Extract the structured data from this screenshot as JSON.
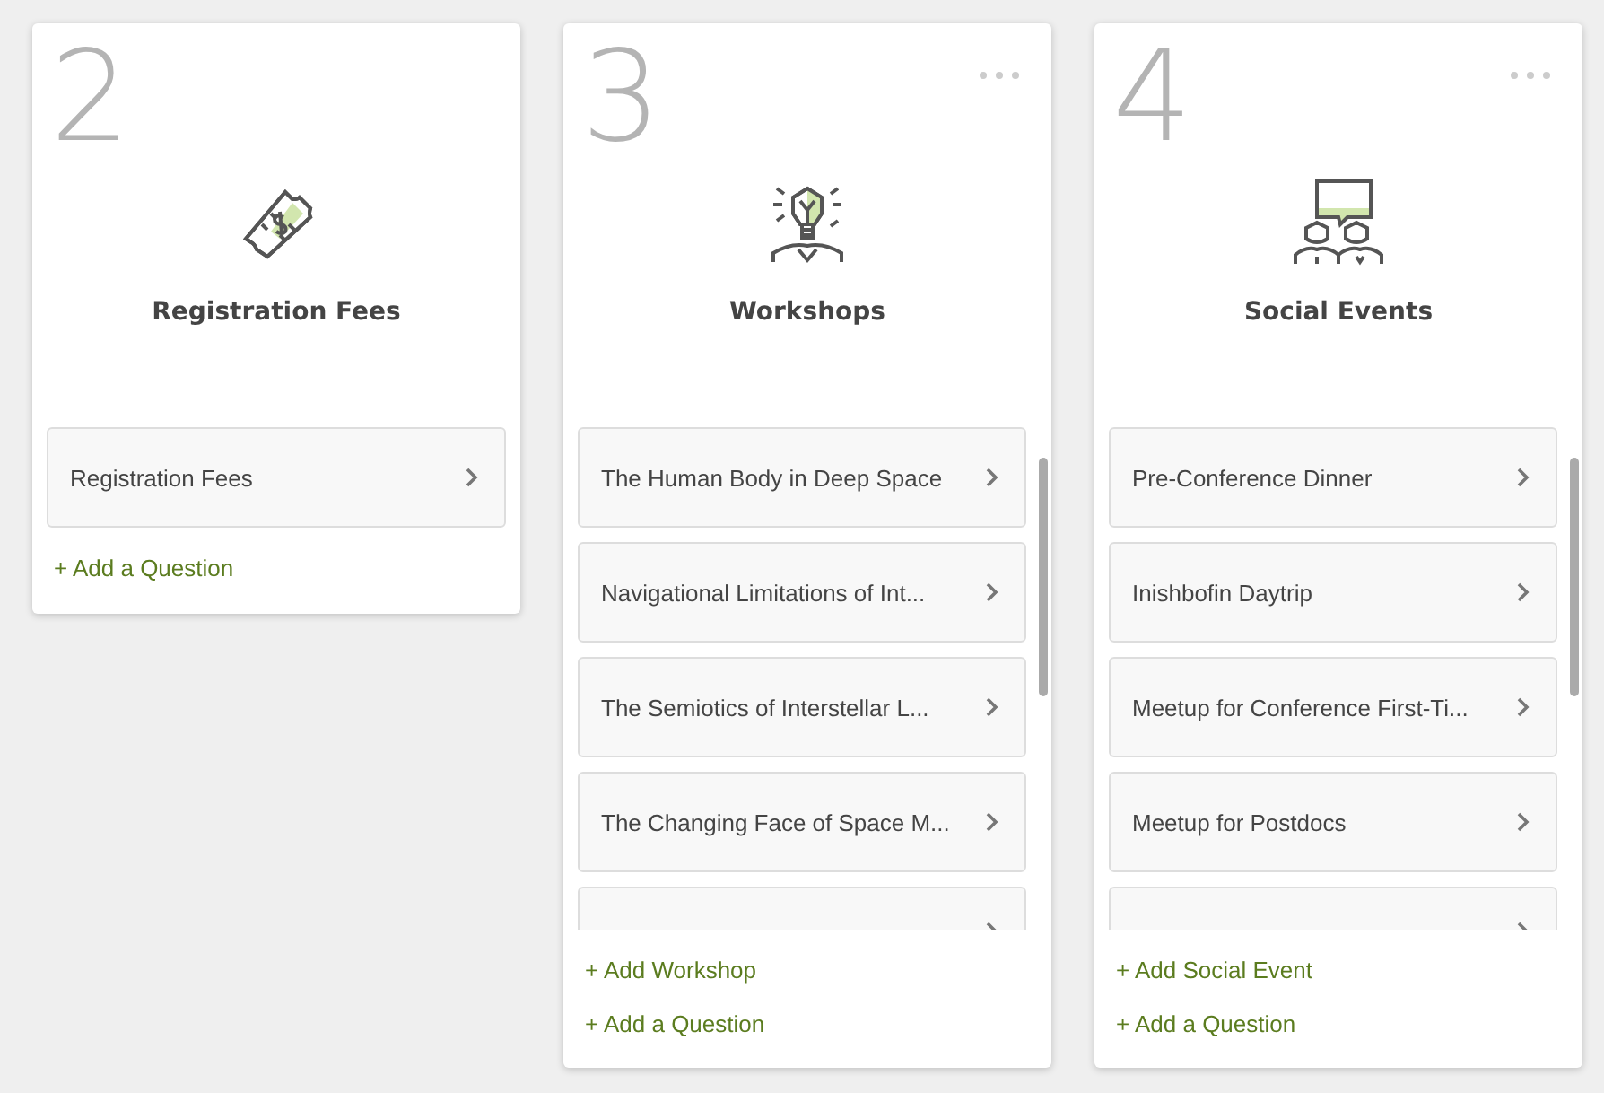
{
  "columns": [
    {
      "number": "2",
      "title": "Registration Fees",
      "menu": false,
      "scrollable": false,
      "items": [
        {
          "kind": "full",
          "label": "Registration Fees"
        }
      ],
      "links": [
        "+ Add a Question"
      ]
    },
    {
      "number": "3",
      "title": "Workshops",
      "menu": true,
      "scrollable": true,
      "items": [
        {
          "kind": "full",
          "label": "The Human Body in Deep Space"
        },
        {
          "kind": "full",
          "label": "Navigational Limitations of Int..."
        },
        {
          "kind": "full",
          "label": "The Semiotics of Interstellar L..."
        },
        {
          "kind": "full",
          "label": "The Changing Face of Space M..."
        },
        {
          "kind": "partial"
        }
      ],
      "links": [
        "+ Add Workshop",
        "+ Add a Question"
      ]
    },
    {
      "number": "4",
      "title": "Social Events",
      "menu": true,
      "scrollable": true,
      "items": [
        {
          "kind": "full",
          "label": "Pre-Conference Dinner"
        },
        {
          "kind": "full",
          "label": "Inishbofin Daytrip"
        },
        {
          "kind": "full",
          "label": "Meetup for Conference First-Ti..."
        },
        {
          "kind": "full",
          "label": "Meetup for Postdocs"
        },
        {
          "kind": "partial"
        }
      ],
      "links": [
        "+ Add Social Event",
        "+ Add a Question"
      ]
    }
  ]
}
